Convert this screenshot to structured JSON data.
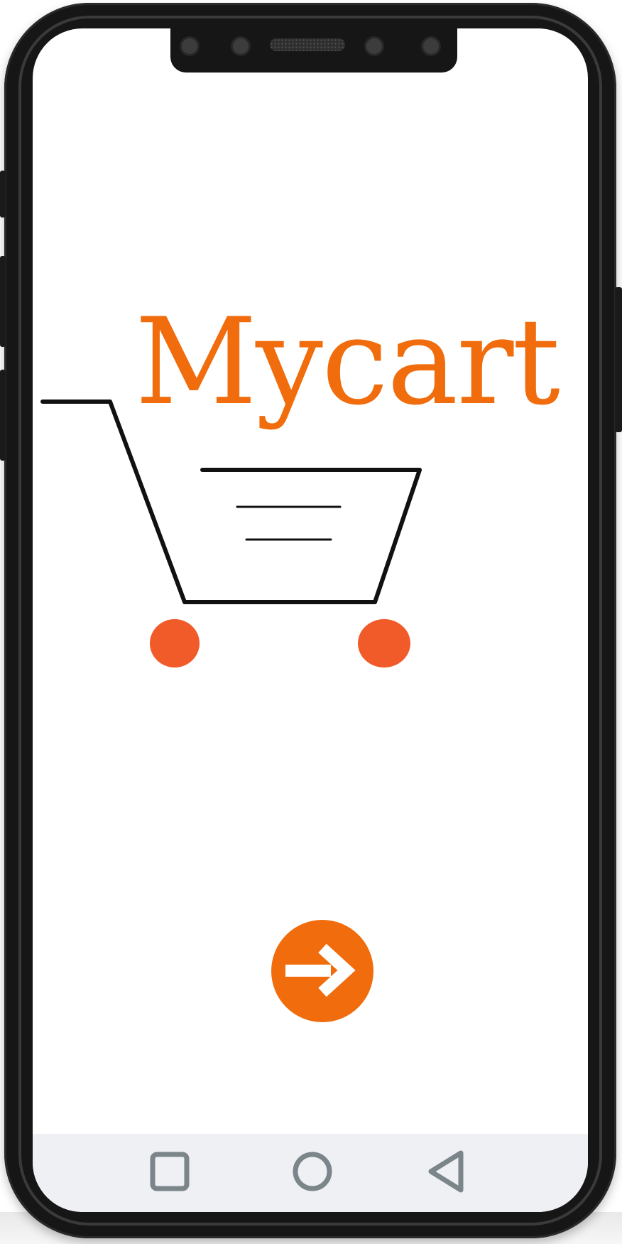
{
  "app": {
    "brand_title": "Mycart"
  },
  "icons": {
    "cart": "shopping-cart-icon",
    "next": "arrow-right-icon",
    "nav_recents": "square-icon",
    "nav_home": "circle-icon",
    "nav_back": "triangle-back-icon"
  },
  "colors": {
    "brand_orange": "#f06c0c",
    "wheel_orange": "#f15a29",
    "nav_icon_gray": "#7b858a",
    "nav_bar_bg": "#eef0f4",
    "frame_black": "#161616"
  }
}
